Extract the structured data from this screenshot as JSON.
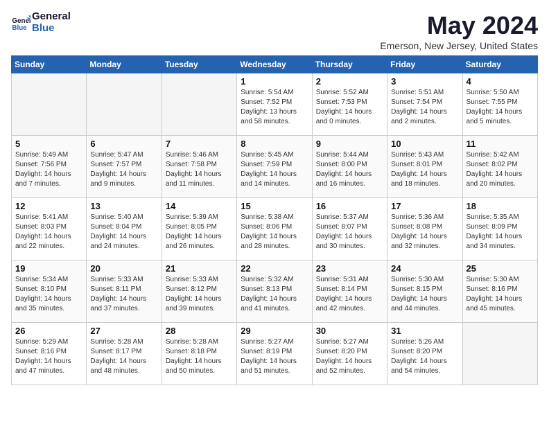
{
  "header": {
    "logo_line1": "General",
    "logo_line2": "Blue",
    "month_year": "May 2024",
    "location": "Emerson, New Jersey, United States"
  },
  "days_of_week": [
    "Sunday",
    "Monday",
    "Tuesday",
    "Wednesday",
    "Thursday",
    "Friday",
    "Saturday"
  ],
  "weeks": [
    [
      {
        "num": "",
        "detail": "",
        "empty": true
      },
      {
        "num": "",
        "detail": "",
        "empty": true
      },
      {
        "num": "",
        "detail": "",
        "empty": true
      },
      {
        "num": "1",
        "detail": "Sunrise: 5:54 AM\nSunset: 7:52 PM\nDaylight: 13 hours\nand 58 minutes."
      },
      {
        "num": "2",
        "detail": "Sunrise: 5:52 AM\nSunset: 7:53 PM\nDaylight: 14 hours\nand 0 minutes."
      },
      {
        "num": "3",
        "detail": "Sunrise: 5:51 AM\nSunset: 7:54 PM\nDaylight: 14 hours\nand 2 minutes."
      },
      {
        "num": "4",
        "detail": "Sunrise: 5:50 AM\nSunset: 7:55 PM\nDaylight: 14 hours\nand 5 minutes."
      }
    ],
    [
      {
        "num": "5",
        "detail": "Sunrise: 5:49 AM\nSunset: 7:56 PM\nDaylight: 14 hours\nand 7 minutes."
      },
      {
        "num": "6",
        "detail": "Sunrise: 5:47 AM\nSunset: 7:57 PM\nDaylight: 14 hours\nand 9 minutes."
      },
      {
        "num": "7",
        "detail": "Sunrise: 5:46 AM\nSunset: 7:58 PM\nDaylight: 14 hours\nand 11 minutes."
      },
      {
        "num": "8",
        "detail": "Sunrise: 5:45 AM\nSunset: 7:59 PM\nDaylight: 14 hours\nand 14 minutes."
      },
      {
        "num": "9",
        "detail": "Sunrise: 5:44 AM\nSunset: 8:00 PM\nDaylight: 14 hours\nand 16 minutes."
      },
      {
        "num": "10",
        "detail": "Sunrise: 5:43 AM\nSunset: 8:01 PM\nDaylight: 14 hours\nand 18 minutes."
      },
      {
        "num": "11",
        "detail": "Sunrise: 5:42 AM\nSunset: 8:02 PM\nDaylight: 14 hours\nand 20 minutes."
      }
    ],
    [
      {
        "num": "12",
        "detail": "Sunrise: 5:41 AM\nSunset: 8:03 PM\nDaylight: 14 hours\nand 22 minutes."
      },
      {
        "num": "13",
        "detail": "Sunrise: 5:40 AM\nSunset: 8:04 PM\nDaylight: 14 hours\nand 24 minutes."
      },
      {
        "num": "14",
        "detail": "Sunrise: 5:39 AM\nSunset: 8:05 PM\nDaylight: 14 hours\nand 26 minutes."
      },
      {
        "num": "15",
        "detail": "Sunrise: 5:38 AM\nSunset: 8:06 PM\nDaylight: 14 hours\nand 28 minutes."
      },
      {
        "num": "16",
        "detail": "Sunrise: 5:37 AM\nSunset: 8:07 PM\nDaylight: 14 hours\nand 30 minutes."
      },
      {
        "num": "17",
        "detail": "Sunrise: 5:36 AM\nSunset: 8:08 PM\nDaylight: 14 hours\nand 32 minutes."
      },
      {
        "num": "18",
        "detail": "Sunrise: 5:35 AM\nSunset: 8:09 PM\nDaylight: 14 hours\nand 34 minutes."
      }
    ],
    [
      {
        "num": "19",
        "detail": "Sunrise: 5:34 AM\nSunset: 8:10 PM\nDaylight: 14 hours\nand 35 minutes."
      },
      {
        "num": "20",
        "detail": "Sunrise: 5:33 AM\nSunset: 8:11 PM\nDaylight: 14 hours\nand 37 minutes."
      },
      {
        "num": "21",
        "detail": "Sunrise: 5:33 AM\nSunset: 8:12 PM\nDaylight: 14 hours\nand 39 minutes."
      },
      {
        "num": "22",
        "detail": "Sunrise: 5:32 AM\nSunset: 8:13 PM\nDaylight: 14 hours\nand 41 minutes."
      },
      {
        "num": "23",
        "detail": "Sunrise: 5:31 AM\nSunset: 8:14 PM\nDaylight: 14 hours\nand 42 minutes."
      },
      {
        "num": "24",
        "detail": "Sunrise: 5:30 AM\nSunset: 8:15 PM\nDaylight: 14 hours\nand 44 minutes."
      },
      {
        "num": "25",
        "detail": "Sunrise: 5:30 AM\nSunset: 8:16 PM\nDaylight: 14 hours\nand 45 minutes."
      }
    ],
    [
      {
        "num": "26",
        "detail": "Sunrise: 5:29 AM\nSunset: 8:16 PM\nDaylight: 14 hours\nand 47 minutes."
      },
      {
        "num": "27",
        "detail": "Sunrise: 5:28 AM\nSunset: 8:17 PM\nDaylight: 14 hours\nand 48 minutes."
      },
      {
        "num": "28",
        "detail": "Sunrise: 5:28 AM\nSunset: 8:18 PM\nDaylight: 14 hours\nand 50 minutes."
      },
      {
        "num": "29",
        "detail": "Sunrise: 5:27 AM\nSunset: 8:19 PM\nDaylight: 14 hours\nand 51 minutes."
      },
      {
        "num": "30",
        "detail": "Sunrise: 5:27 AM\nSunset: 8:20 PM\nDaylight: 14 hours\nand 52 minutes."
      },
      {
        "num": "31",
        "detail": "Sunrise: 5:26 AM\nSunset: 8:20 PM\nDaylight: 14 hours\nand 54 minutes."
      },
      {
        "num": "",
        "detail": "",
        "empty": true
      }
    ]
  ]
}
